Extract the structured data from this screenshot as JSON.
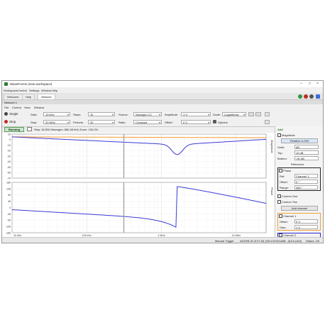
{
  "window": {
    "title": "WaveForms (new workspace)"
  },
  "menubar": {
    "items": [
      "Workspace",
      "Control",
      "Settings",
      "Window",
      "Help"
    ]
  },
  "tabs": [
    "Welcome",
    "Help",
    "Network"
  ],
  "instrument": {
    "tab": "Network 1"
  },
  "submenu": {
    "items": [
      "File",
      "Control",
      "View",
      "Window"
    ]
  },
  "controls": {
    "single": "Single",
    "stop": "Stop",
    "start_label": "Start:",
    "start_value": "10 kHz",
    "stop_label": "Stop:",
    "stop_value": "20 MHz",
    "steps_label": "Steps:",
    "steps_value": "1k",
    "periods_label": "Periods:",
    "periods_value": "32",
    "source_label": "Source:",
    "source_value": "Wavegen C1",
    "ratio_label": "Ratio:",
    "ratio_value": "Constant",
    "amplitude_label": "Amplitude:",
    "amplitude_value": "1 V",
    "offset_label": "Offset:",
    "offset_value": "0 V",
    "scale_label": "Scale:",
    "scale_value": "Logarithmic",
    "options": "Options"
  },
  "status_strip": {
    "running": "Running",
    "info": "Step: 61/300  Wavegen: 880.48 kHz  Zoom: 100.0%"
  },
  "plots": {
    "top_side_label": "Magnitude",
    "bottom_side_label": "Phase",
    "mag_y_ticks": [
      "10",
      "0",
      "-10",
      "-20",
      "-30",
      "-40",
      "-50",
      "-60",
      "-70"
    ],
    "phase_y_ticks": [
      "180",
      "135",
      "90",
      "45",
      "0",
      "-45",
      "-90",
      "-135",
      "-180"
    ],
    "x_ticks": [
      "10 kHz",
      "100 kHz",
      "1 MHz",
      "10 MHz"
    ],
    "x_axis_start": "10 kHz"
  },
  "right_panel": {
    "header": "Add",
    "magnitude": "Magnitude",
    "relative_btn": "Relative to Ref",
    "units_label": "Units:",
    "units_value": "dB",
    "top_label": "Top:",
    "top_value": "10 dB",
    "bottom_label": "Bottom:",
    "bottom_value": "-90 dB",
    "reference_link": "Reference",
    "phase": "Phase",
    "ref_label": "Ref:",
    "ref_value": "Channel 1",
    "offset_label": "Offset:",
    "offset_value": "0 °",
    "range_label": "Range:",
    "range_value": "360 °",
    "custom_one": "Custom One",
    "custom_two": "Custom Two",
    "add_channel": "Add channel",
    "channel1": "Channel 1",
    "ch1_offset_label": "Offset:",
    "ch1_offset_value": "0 V",
    "ch1_gain_label": "Gain:",
    "ch1_gain_value": "1 X",
    "channel2": "Channel 2",
    "ch2_offset_label": "Offset:",
    "ch2_offset_value": "0 V"
  },
  "statusbar": {
    "manual_trigger": "Manual Trigger",
    "device": "AD2SB-S2-EXT-Dlr (SN:210321A6B ...)",
    "version": "3.8.8 (x64)",
    "status": "Status: OK"
  },
  "colors": {
    "magnitude_orange": "#f29a2e",
    "magnitude_blue": "#3a3ad8",
    "phase_blue": "#3a3ad8",
    "cursor": "#9a9a9a",
    "highlight_orange": "#f0a030",
    "highlight_blue": "#2828d0"
  }
}
